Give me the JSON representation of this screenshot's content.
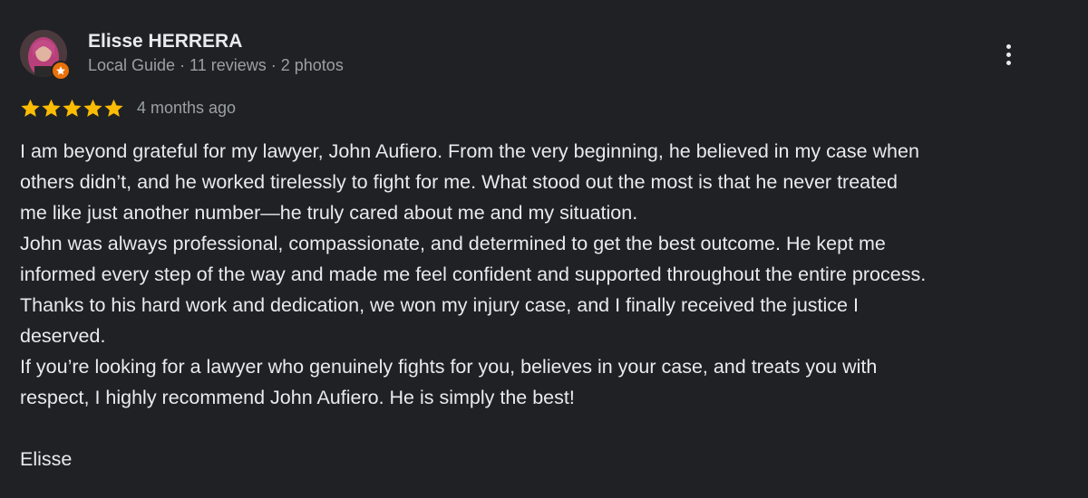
{
  "author": {
    "name": "Elisse HERRERA",
    "meta": "Local Guide · 11 reviews · 2 photos",
    "avatar_icon": "user-photo",
    "badge_icon": "local-guide-star-icon",
    "badge_color": "#e8710a"
  },
  "menu": {
    "icon": "more-vert-icon"
  },
  "rating": {
    "stars": 5,
    "max_stars": 5,
    "star_color": "#fbbc04",
    "date": "4 months ago"
  },
  "review": {
    "lines": [
      "I am beyond grateful for my lawyer, John Aufiero. From the very beginning, he believed in my case when",
      "others didn’t, and he worked tirelessly to fight for me. What stood out the most is that he never treated",
      "me like just another number—he truly cared about me and my situation.",
      "John was always professional, compassionate, and determined to get the best outcome. He kept me",
      "informed every step of the way and made me feel confident and supported throughout the entire process.",
      "Thanks to his hard work and dedication, we won my injury case, and I finally received the justice I",
      "deserved.",
      "If you’re looking for a lawyer who genuinely fights for you, believes in your case, and treats you with",
      "respect, I highly recommend John Aufiero. He is simply the best!",
      "",
      "Elisse"
    ]
  },
  "colors": {
    "background": "#202124",
    "primary_text": "#e8eaed",
    "secondary_text": "#9aa0a6"
  }
}
